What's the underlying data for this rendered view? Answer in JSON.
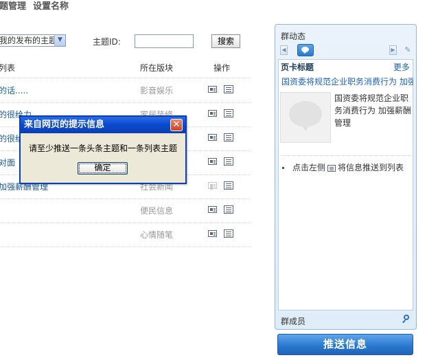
{
  "top_tabs": [
    "主题管理",
    "设置名称"
  ],
  "filter": {
    "select_value": "我的发布的主题",
    "topic_id_label": "主题ID:",
    "topic_id_value": "",
    "search_label": "搜索"
  },
  "table": {
    "headers": [
      "列表",
      "所在版块",
      "操作"
    ],
    "rows": [
      {
        "title": "的话.....",
        "board": "影音娱乐",
        "op_disabled": false
      },
      {
        "title": "的很给力",
        "board": "家居装修",
        "op_disabled": false
      },
      {
        "title": "的很给",
        "board": "",
        "op_disabled": false
      },
      {
        "title": "对面",
        "board": "",
        "op_disabled": false
      },
      {
        "title": "加强薪酬管理",
        "board": "社会新闻",
        "op_disabled": true
      },
      {
        "title": "",
        "board": "便民信息",
        "op_disabled": false
      },
      {
        "title": "",
        "board": "心情随笔",
        "op_disabled": false
      }
    ]
  },
  "dialog": {
    "title": "来自网页的提示信息",
    "message": "请至少推送一条头条主题和一条列表主题",
    "ok_label": "确定"
  },
  "panel": {
    "title": "群动态",
    "card_title": "页卡标题",
    "more_label": "更多",
    "headline_link": "国资委将规范企业职务消费行为 加强薪酬管理",
    "thumb_text": "国资委将规范企业职务消费行为 加强薪酬管理",
    "hint_prefix": "点击左侧",
    "hint_suffix": "将信息推送到列表",
    "members_label": "群成员"
  },
  "push_button_label": "推送信息"
}
